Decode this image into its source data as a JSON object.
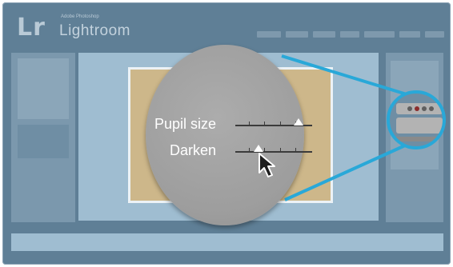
{
  "app": {
    "brand_small": "Adobe Photoshop",
    "brand_name": "Lightroom",
    "logo_mark": "Lr"
  },
  "loupe": {
    "pupil_label": "Pupil size",
    "darken_label": "Darken",
    "pupil_value": 0.82,
    "darken_value": 0.3
  },
  "colors": {
    "window_bg": "#5f7f96",
    "accent_callout": "#29a8d8",
    "loupe_gray": "#9d9d9d",
    "photo": "#cdb78a"
  },
  "icons": {
    "cursor": "arrow-pointer-icon",
    "callout": "zoom-callout-icon"
  }
}
